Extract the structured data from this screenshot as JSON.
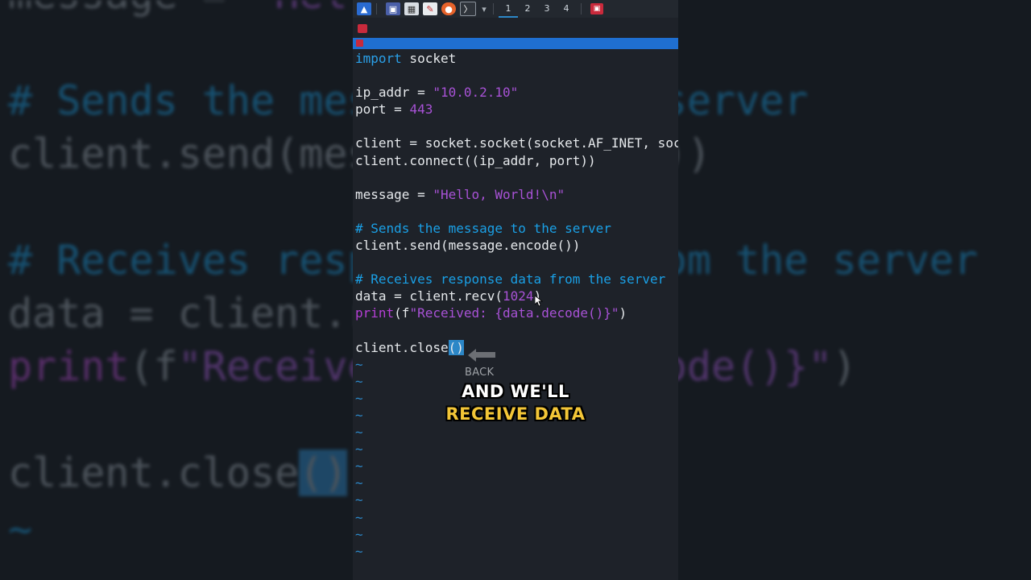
{
  "taskbar": {
    "workspaces": [
      "1",
      "2",
      "3",
      "4"
    ],
    "active_workspace": "1"
  },
  "code_lines": [
    {
      "parts": [
        {
          "t": "import",
          "c": "kw"
        },
        {
          "t": " socket",
          "c": ""
        }
      ]
    },
    {
      "parts": []
    },
    {
      "parts": [
        {
          "t": "ip_addr = ",
          "c": ""
        },
        {
          "t": "\"10.0.2.10\"",
          "c": "str"
        }
      ]
    },
    {
      "parts": [
        {
          "t": "port = ",
          "c": ""
        },
        {
          "t": "443",
          "c": "num"
        }
      ]
    },
    {
      "parts": []
    },
    {
      "parts": [
        {
          "t": "client = socket.socket(socket.AF_INET, socket.SOCK_STREAM)",
          "c": ""
        }
      ]
    },
    {
      "parts": [
        {
          "t": "client.connect((ip_addr, port))",
          "c": ""
        }
      ]
    },
    {
      "parts": []
    },
    {
      "parts": [
        {
          "t": "message = ",
          "c": ""
        },
        {
          "t": "\"Hello, World!\\n\"",
          "c": "str"
        }
      ]
    },
    {
      "parts": []
    },
    {
      "parts": [
        {
          "t": "# Sends the message to the server",
          "c": "cm"
        }
      ]
    },
    {
      "parts": [
        {
          "t": "client.send(message.encode())",
          "c": ""
        }
      ]
    },
    {
      "parts": []
    },
    {
      "parts": [
        {
          "t": "# Receives response data from the server",
          "c": "cm"
        }
      ]
    },
    {
      "parts": [
        {
          "t": "data = client.recv(",
          "c": ""
        },
        {
          "t": "1024",
          "c": "num"
        },
        {
          "t": ")",
          "c": ""
        }
      ]
    },
    {
      "parts": [
        {
          "t": "print",
          "c": "fn"
        },
        {
          "t": "(f",
          "c": ""
        },
        {
          "t": "\"Received: {data.decode()}\"",
          "c": "str"
        },
        {
          "t": ")",
          "c": ""
        }
      ]
    },
    {
      "parts": []
    },
    {
      "parts": [
        {
          "t": "client.close",
          "c": ""
        },
        {
          "t": "()",
          "c": "sel"
        }
      ]
    },
    {
      "parts": [
        {
          "t": "~",
          "c": "tilde"
        }
      ]
    },
    {
      "parts": [
        {
          "t": "~",
          "c": "tilde"
        }
      ]
    },
    {
      "parts": [
        {
          "t": "~",
          "c": "tilde"
        }
      ]
    },
    {
      "parts": [
        {
          "t": "~",
          "c": "tilde"
        }
      ]
    },
    {
      "parts": [
        {
          "t": "~",
          "c": "tilde"
        }
      ]
    },
    {
      "parts": [
        {
          "t": "~",
          "c": "tilde"
        }
      ]
    },
    {
      "parts": [
        {
          "t": "~",
          "c": "tilde"
        }
      ]
    },
    {
      "parts": [
        {
          "t": "~",
          "c": "tilde"
        }
      ]
    },
    {
      "parts": [
        {
          "t": "~",
          "c": "tilde"
        }
      ]
    },
    {
      "parts": [
        {
          "t": "~",
          "c": "tilde"
        }
      ]
    },
    {
      "parts": [
        {
          "t": "~",
          "c": "tilde"
        }
      ]
    },
    {
      "parts": [
        {
          "t": "~",
          "c": "tilde"
        }
      ]
    }
  ],
  "background_zoom": [
    {
      "parts": [
        {
          "t": "message = \"",
          "c": ""
        },
        {
          "t": "Hello, World!\\n",
          "c": "s"
        },
        {
          "t": "\"",
          "c": ""
        }
      ]
    },
    {
      "parts": [
        {
          "t": "# Sends the message to the server",
          "c": "c"
        }
      ]
    },
    {
      "parts": [
        {
          "t": "client.send(message.encode())",
          "c": ""
        }
      ]
    },
    {
      "parts": [
        {
          "t": "# Receives response data from the server",
          "c": "c"
        }
      ]
    },
    {
      "parts": [
        {
          "t": "data = client.recv(1024)",
          "c": ""
        }
      ]
    },
    {
      "parts": [
        {
          "t": "print",
          "c": "p"
        },
        {
          "t": "(f",
          "c": ""
        },
        {
          "t": "\"Received: {data.decode()}\"",
          "c": "s"
        },
        {
          "t": ")",
          "c": ""
        }
      ]
    },
    {
      "parts": [
        {
          "t": "client.close",
          "c": ""
        },
        {
          "t": "()",
          "c": "sel"
        }
      ]
    },
    {
      "parts": [
        {
          "t": "~",
          "c": "c"
        }
      ]
    }
  ],
  "back_hint": {
    "label": "BACK"
  },
  "caption": {
    "line1": "AND WE'LL",
    "line2": "RECEIVE DATA"
  },
  "colors": {
    "keyword": "#2aa1ea",
    "string": "#a852d6",
    "comment": "#1aa0e6",
    "selection": "#2c87c7",
    "caption_highlight": "#f3c637"
  }
}
